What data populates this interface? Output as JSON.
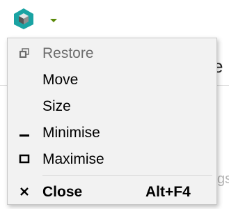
{
  "background": {
    "partial_text_right": "e",
    "partial_text_faded": "gs"
  },
  "colors": {
    "menu_background": "#f2f2f2",
    "icon_teal": "#1aa3a3",
    "dropdown_arrow": "#5b8a0a",
    "disabled_text": "#6d6d6d"
  },
  "menu": {
    "items": [
      {
        "label": "Restore",
        "icon": "restore-icon",
        "enabled": false
      },
      {
        "label": "Move",
        "icon": "",
        "enabled": true
      },
      {
        "label": "Size",
        "icon": "",
        "enabled": true
      },
      {
        "label": "Minimise",
        "icon": "minimise-icon",
        "enabled": true
      },
      {
        "label": "Maximise",
        "icon": "maximise-icon",
        "enabled": true
      },
      {
        "label": "Close",
        "icon": "close-icon",
        "enabled": true,
        "bold": true,
        "shortcut": "Alt+F4"
      }
    ]
  }
}
